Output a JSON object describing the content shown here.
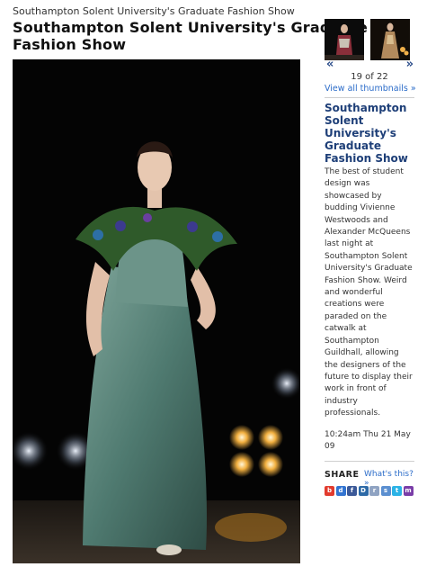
{
  "header": {
    "breadcrumb": "Southampton Solent University's Graduate Fashion Show",
    "title": "Southampton Solent University's Graduate Fashion Show"
  },
  "main_image": {
    "description_icon": "fashion-runway-photo"
  },
  "gallery": {
    "prev_arrow": "«",
    "next_arrow": "»",
    "counter": "19 of 22",
    "view_all": "View all thumbnails »"
  },
  "article": {
    "title": "Southampton Solent University's Graduate Fashion Show",
    "body": "The best of student design was showcased by budding Vivienne Westwoods and Alexander McQueens last night at Southampton Solent University's Graduate Fashion Show. Weird and wonderful creations were paraded on the catwalk at Southampton Guildhall, allowing the designers of the future to display their work in front of industry professionals.",
    "timestamp": "10:24am Thu 21 May 09"
  },
  "share": {
    "label": "SHARE",
    "whats_this": "What's this? »",
    "icons": [
      {
        "name": "bebo-icon",
        "glyph": "b",
        "color": "#e23b2e"
      },
      {
        "name": "delicious-icon",
        "glyph": "d",
        "color": "#3274d1"
      },
      {
        "name": "facebook-icon",
        "glyph": "f",
        "color": "#3b5998"
      },
      {
        "name": "digg-icon",
        "glyph": "D",
        "color": "#2d6aa7"
      },
      {
        "name": "reddit-icon",
        "glyph": "r",
        "color": "#8fa3c2"
      },
      {
        "name": "stumbleupon-icon",
        "glyph": "s",
        "color": "#5b8fd0"
      },
      {
        "name": "twitter-icon",
        "glyph": "t",
        "color": "#2bb3e6"
      },
      {
        "name": "myspace-icon",
        "glyph": "m",
        "color": "#7a3ea8"
      }
    ]
  }
}
